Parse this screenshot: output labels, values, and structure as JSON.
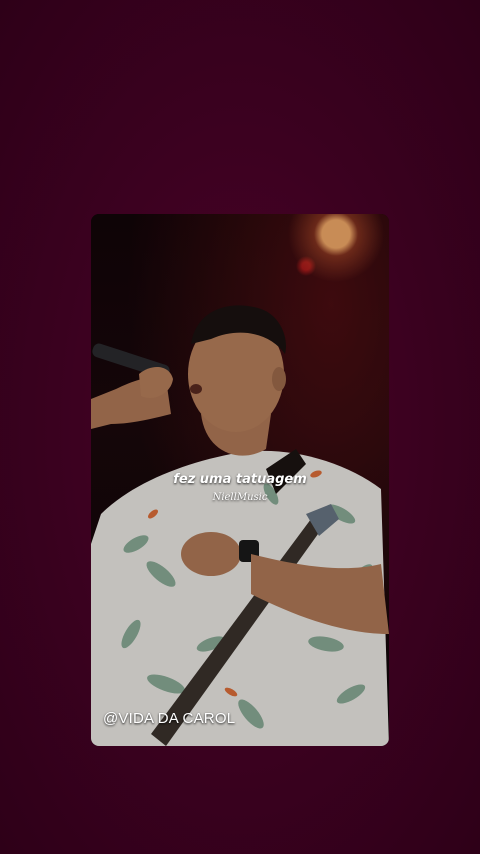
{
  "story": {
    "lyric": "fez uma tatuagem",
    "credit": "NiellMusic",
    "watermark": "@VIDA DA CAROL"
  },
  "colors": {
    "background": "#3d0120",
    "shirt": "#f2f0ec",
    "leaf_print": "#7aa38b"
  }
}
